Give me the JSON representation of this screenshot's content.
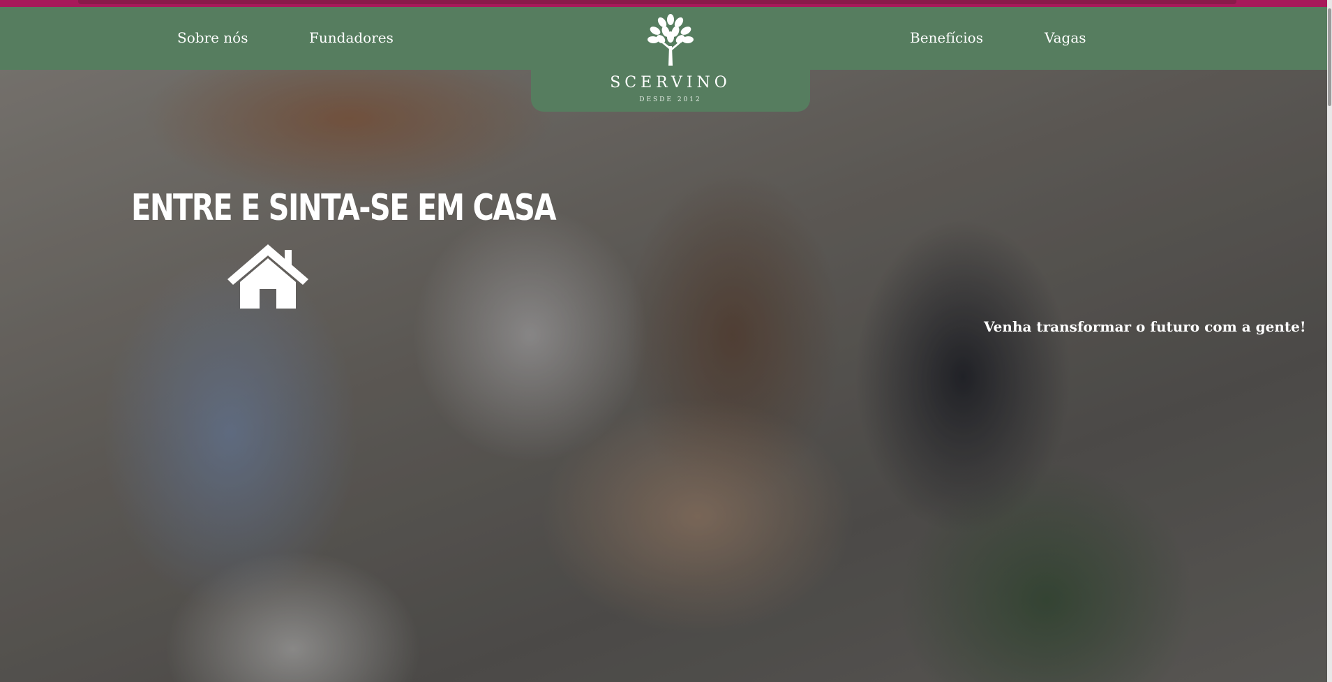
{
  "nav": {
    "links": [
      {
        "label": "Sobre nós"
      },
      {
        "label": "Fundadores"
      },
      {
        "label": "Benefícios"
      },
      {
        "label": "Vagas"
      }
    ],
    "logo": {
      "name": "SCERVINO",
      "subtitle": "DESDE 2012"
    }
  },
  "hero": {
    "title": "ENTRE E SINTA-SE EM CASA",
    "icon": "home-icon",
    "tagline": "Venha transformar o futuro com a gente!"
  },
  "colors": {
    "nav_green": "#567d5f",
    "top_bar_magenta": "#a8195a",
    "text": "#ffffff"
  }
}
